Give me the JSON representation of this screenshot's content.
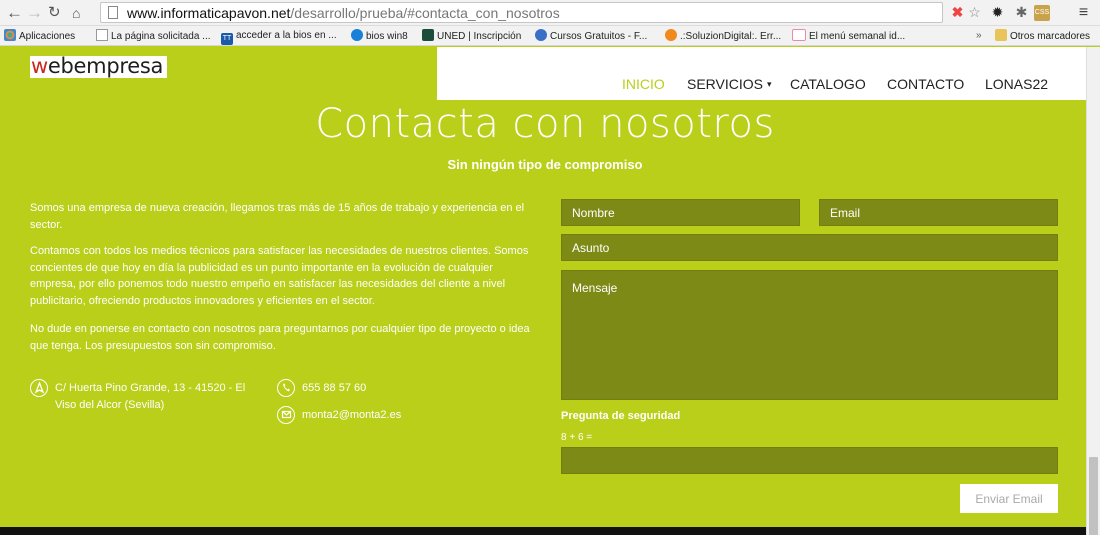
{
  "browser": {
    "url_host": "www.informaticapavon.net",
    "url_path": "/desarrollo/prueba/#contacta_con_nosotros",
    "bookmarks": [
      "Aplicaciones",
      "La página solicitada ...",
      "acceder a la bios en ...",
      "bios win8",
      "UNED | Inscripción",
      "Cursos Gratuitos - F...",
      ".:SoluzionDigital:. Err...",
      "El menú semanal id..."
    ],
    "more_label": "»",
    "other_bookmarks": "Otros marcadores",
    "css_ext": "CSS",
    "tt_icon": "TT"
  },
  "site": {
    "logo_w": "w",
    "logo_rest": "ebempresa",
    "nav": [
      {
        "label": "INICIO",
        "active": true
      },
      {
        "label": "SERVICIOS",
        "caret": "▾"
      },
      {
        "label": "CATALOGO"
      },
      {
        "label": "CONTACTO"
      },
      {
        "label": "LONAS22"
      }
    ]
  },
  "hero": {
    "title": "Contacta con nosotros",
    "subtitle": "Sin ningún tipo de compromiso"
  },
  "about": {
    "p1": "Somos una empresa de nueva creación, llegamos tras más de 15 años de trabajo y experiencia en el sector.",
    "p2": "Contamos con todos los medios técnicos para satisfacer las necesidades de nuestros clientes. Somos concientes de que hoy en día la publicidad es un punto importante en la evolución de cualquier empresa, por ello ponemos todo nuestro empeño en satisfacer las necesidades del cliente a nivel publicitario, ofreciendo productos innovadores y eficientes en el sector.",
    "p3": "No dude en ponerse en contacto con nosotros para preguntarnos por cualquier tipo de proyecto o idea que tenga. Los presupuestos son sin compromiso."
  },
  "contact": {
    "address": "C/ Huerta Pino Grande, 13 - 41520 - El Viso del Alcor (Sevilla)",
    "phone": "655 88 57 60",
    "email": "monta2@monta2.es"
  },
  "form": {
    "name_placeholder": "Nombre",
    "email_placeholder": "Email",
    "subject_placeholder": "Asunto",
    "message_placeholder": "Mensaje",
    "security_label": "Pregunta de seguridad",
    "security_question": "8 + 6 =",
    "captcha_value": "",
    "submit_label": "Enviar Email"
  },
  "colors": {
    "brand_green": "#b9cf1a",
    "field_bg": "#7e8a16",
    "logo_red": "#c8281e"
  }
}
